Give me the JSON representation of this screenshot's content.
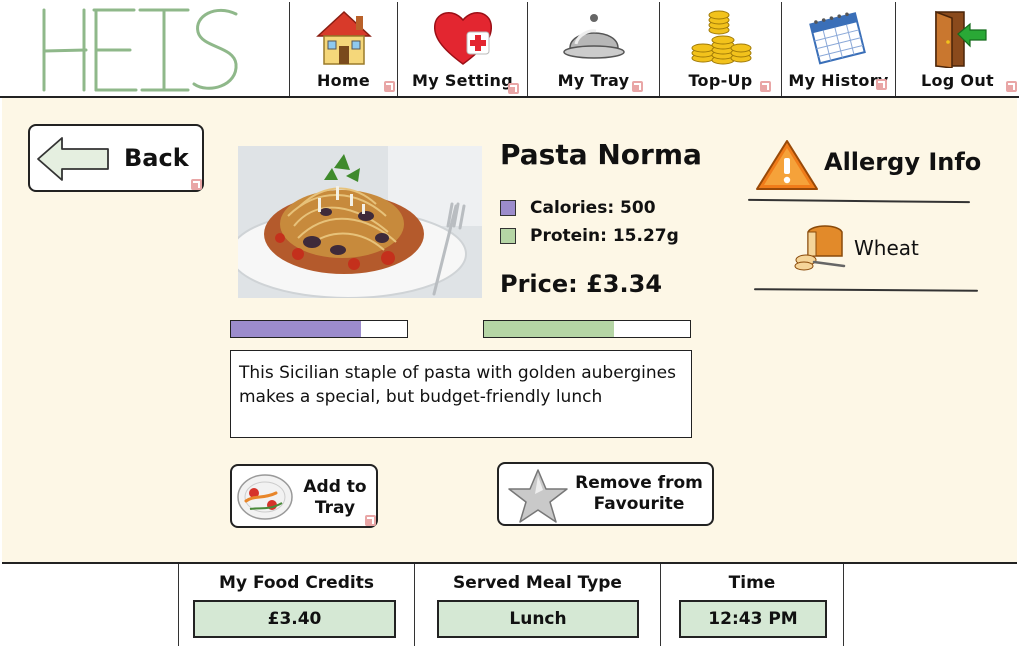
{
  "app": {
    "logo_text": "HEIS",
    "logo_color": "#8fb88a"
  },
  "nav": {
    "items": [
      {
        "label": "Home",
        "icon": "house-icon"
      },
      {
        "label": "My Setting",
        "icon": "heart-plus-icon"
      },
      {
        "label": "My Tray",
        "icon": "cloche-icon"
      },
      {
        "label": "Top-Up",
        "icon": "gold-coins-icon"
      },
      {
        "label": "My History",
        "icon": "calendar-icon"
      },
      {
        "label": "Log Out",
        "icon": "exit-door-icon"
      }
    ]
  },
  "main": {
    "back_label": "Back",
    "dish": {
      "name": "Pasta Norma",
      "image": "pasta-dish-photo",
      "calories_label": "Calories: 500",
      "protein_label": "Protein: 15.27g",
      "price_label": "Price: £3.34",
      "calories_fraction": 0.74,
      "protein_fraction": 0.63,
      "description": "This Sicilian staple of pasta with golden aubergines makes a special, but budget-friendly lunch"
    },
    "actions": {
      "add_to_tray_label_line1": "Add to",
      "add_to_tray_label_line2": "Tray",
      "remove_favourite_label_line1": "Remove from",
      "remove_favourite_label_line2": "Favourite"
    },
    "allergy": {
      "heading": "Allergy Info",
      "items": [
        {
          "label": "Wheat",
          "icon": "bread-icon"
        }
      ]
    }
  },
  "footer": {
    "credits_label": "My Food Credits",
    "credits_value": "£3.40",
    "meal_type_label": "Served Meal Type",
    "meal_type_value": "Lunch",
    "time_label": "Time",
    "time_value": "12:43 PM"
  },
  "colors": {
    "panel_background": "#fdf7e6",
    "calories_color": "#9c8ccc",
    "protein_color": "#b5d5a5",
    "value_box": "#d5e8d4",
    "link_marker": "#e9a6a6"
  }
}
